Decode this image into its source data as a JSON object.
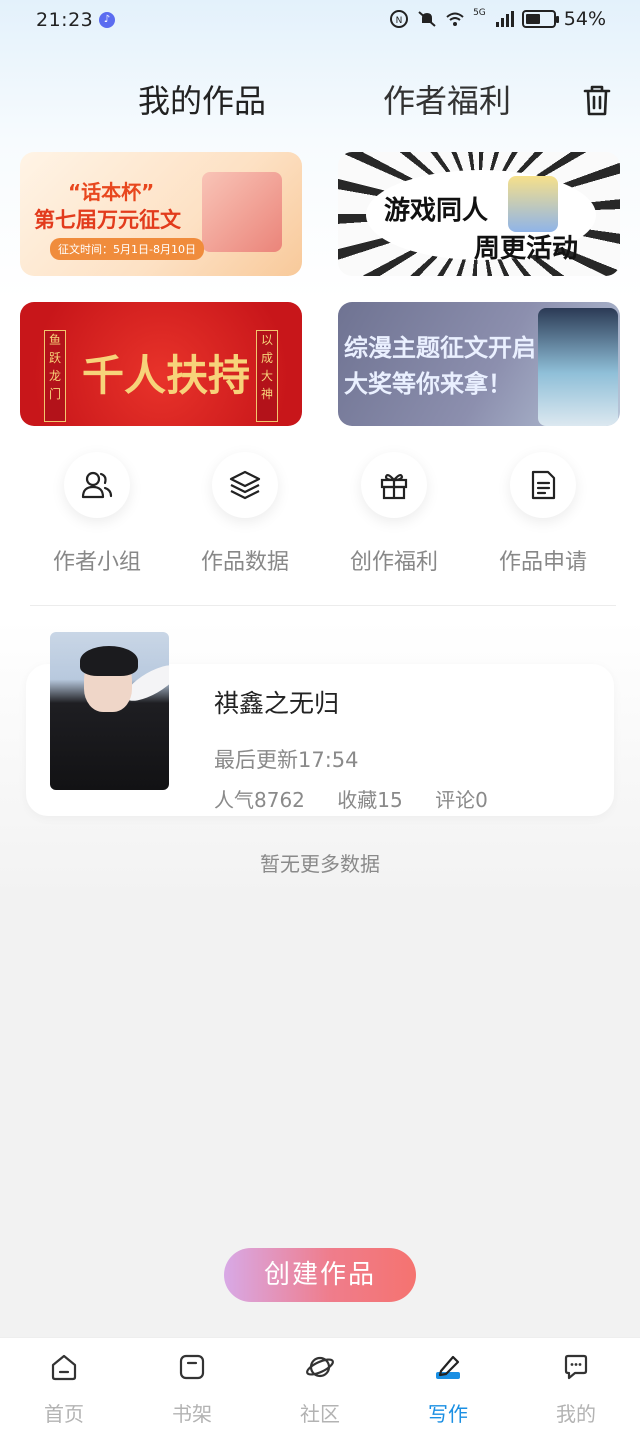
{
  "status_bar": {
    "time": "21:23",
    "network_badge": "5G",
    "battery_text": "54%",
    "battery_level": 0.54
  },
  "header": {
    "tabs": [
      {
        "label": "我的作品",
        "active": true
      },
      {
        "label": "作者福利",
        "active": false
      }
    ]
  },
  "banners": [
    {
      "line1": "“话本杯”",
      "line2": "第七届万元征文",
      "line3": "征文时间：5月1日-8月10日"
    },
    {
      "line1": "游戏同人",
      "line2": "周更活动"
    },
    {
      "line1": "千人扶持",
      "left_scroll": "鱼跃龙门",
      "right_scroll": "以成大神"
    },
    {
      "line1": "综漫主题征文开启",
      "line2": "大奖等你来拿！"
    }
  ],
  "actions": [
    {
      "label": "作者小组",
      "icon": "users-icon"
    },
    {
      "label": "作品数据",
      "icon": "layers-icon"
    },
    {
      "label": "创作福利",
      "icon": "gift-icon"
    },
    {
      "label": "作品申请",
      "icon": "document-icon"
    }
  ],
  "work": {
    "title": "祺鑫之无归",
    "updated": "最后更新17:54",
    "popularity": "人气8762",
    "favorites": "收藏15",
    "comments": "评论0"
  },
  "no_more_text": "暂无更多数据",
  "create_button_label": "创建作品",
  "bottom_nav": [
    {
      "label": "首页",
      "icon": "home-icon",
      "active": false
    },
    {
      "label": "书架",
      "icon": "bookshelf-icon",
      "active": false
    },
    {
      "label": "社区",
      "icon": "planet-icon",
      "active": false
    },
    {
      "label": "写作",
      "icon": "pen-icon",
      "active": true
    },
    {
      "label": "我的",
      "icon": "chat-icon",
      "active": false
    }
  ],
  "colors": {
    "accent": "#1a8fe3",
    "create_gradient_start": "#d8a9e6",
    "create_gradient_end": "#f57370",
    "muted_text": "#8a8a8a"
  }
}
